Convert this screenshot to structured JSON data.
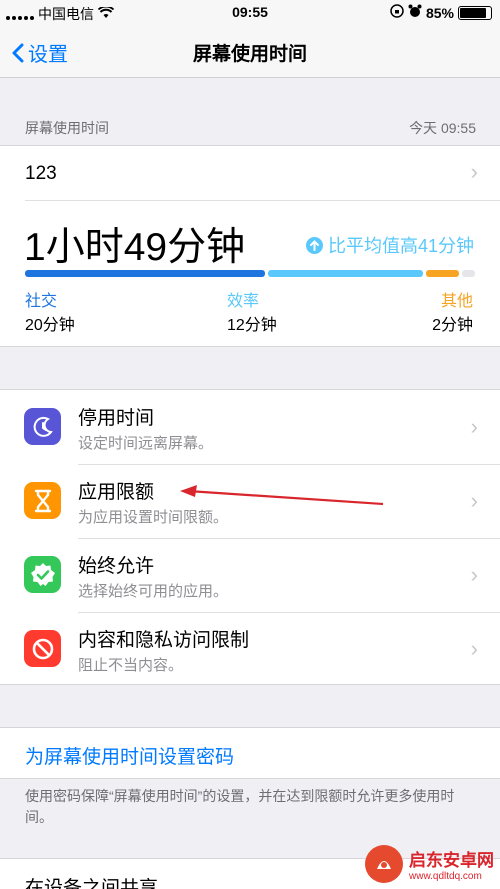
{
  "status": {
    "carrier": "中国电信",
    "time": "09:55",
    "battery": "85%",
    "battery_level": 0.85
  },
  "nav": {
    "back_label": "设置",
    "title": "屏幕使用时间"
  },
  "summary_header": {
    "label": "屏幕使用时间",
    "date": "今天 09:55"
  },
  "device": {
    "name": "123"
  },
  "usage": {
    "total": "1小时49分钟",
    "compare": "比平均值高41分钟",
    "categories": [
      {
        "name": "社交",
        "value": "20分钟",
        "minutes": 20,
        "color": "#1f75e0"
      },
      {
        "name": "效率",
        "value": "12分钟",
        "minutes": 12,
        "color": "#5ac8fa"
      },
      {
        "name": "其他",
        "value": "2分钟",
        "minutes": 2,
        "color": "#f7a323"
      }
    ]
  },
  "menu": [
    {
      "title": "停用时间",
      "subtitle": "设定时间远离屏幕。",
      "icon": "downtime-icon",
      "color": "#5856d6"
    },
    {
      "title": "应用限额",
      "subtitle": "为应用设置时间限额。",
      "icon": "hourglass-icon",
      "color": "#ff9500"
    },
    {
      "title": "始终允许",
      "subtitle": "选择始终可用的应用。",
      "icon": "check-badge-icon",
      "color": "#34c759"
    },
    {
      "title": "内容和隐私访问限制",
      "subtitle": "阻止不当内容。",
      "icon": "prohibited-icon",
      "color": "#ff3b30"
    }
  ],
  "passcode": {
    "link": "为屏幕使用时间设置密码",
    "note": "使用密码保障“屏幕使用时间”的设置，并在达到限额时允许更多使用时间。"
  },
  "share": {
    "label": "在设备之间共享"
  },
  "watermark": {
    "text": "启东安卓网",
    "url": "www.qdltdq.com"
  }
}
